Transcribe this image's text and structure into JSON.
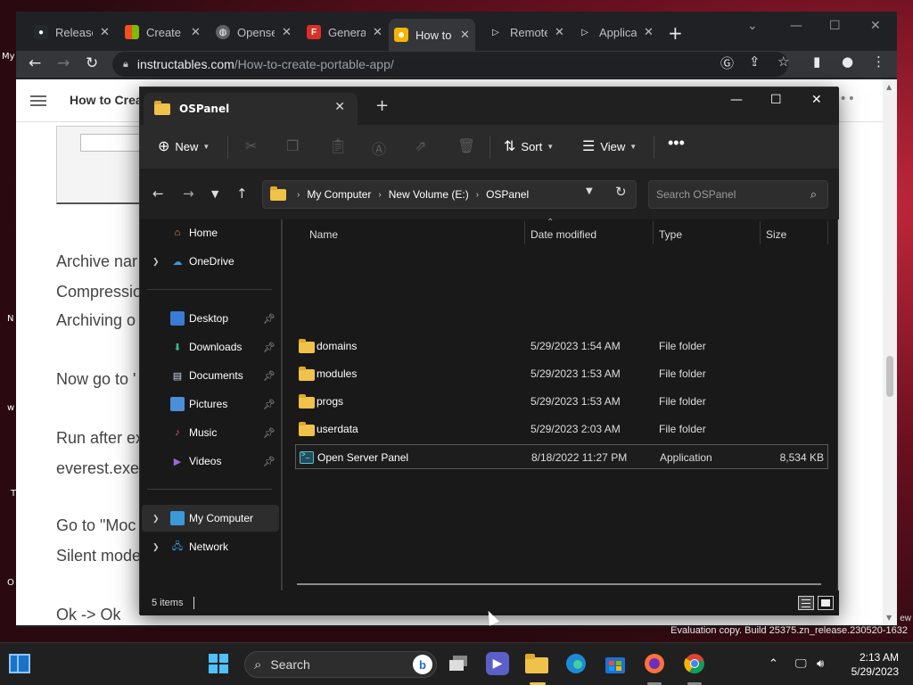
{
  "browser": {
    "tabs": [
      {
        "label": "Releases",
        "favicon": "github-icon",
        "color": "#24292e"
      },
      {
        "label": "Create",
        "favicon": "microsoft-icon",
        "color": "#f25022"
      },
      {
        "label": "Openserver",
        "favicon": "globe-icon",
        "color": "#5f6368"
      },
      {
        "label": "Generate",
        "favicon": "f-icon",
        "color": "#d93025"
      },
      {
        "label": "How to create",
        "favicon": "instructables-icon",
        "color": "#f4b400"
      },
      {
        "label": "Remote",
        "favicon": "play-icon",
        "color": "#202124"
      },
      {
        "label": "Application",
        "favicon": "play-icon",
        "color": "#202124"
      }
    ],
    "url_host": "instructables.com",
    "url_path": "/How-to-create-portable-app/",
    "page_title": "How to Crea",
    "page_lines": [
      "Archive nar",
      "Compressio",
      "Archiving o",
      "Now go to '",
      "Run after ex",
      "everest.exe",
      "Go to \"Moc",
      "Silent mode",
      "Ok -> Ok"
    ]
  },
  "explorer": {
    "tab_title": "OSPanel",
    "commands": {
      "new": "New",
      "sort": "Sort",
      "view": "View"
    },
    "breadcrumb": [
      "My Computer",
      "New Volume (E:)",
      "OSPanel"
    ],
    "search_placeholder": "Search OSPanel",
    "sidebar": [
      {
        "label": "Home",
        "icon": "home-icon",
        "expandable": false
      },
      {
        "label": "OneDrive",
        "icon": "cloud-icon",
        "expandable": true
      },
      {
        "label": "Desktop",
        "icon": "desktop-icon",
        "pinned": true
      },
      {
        "label": "Downloads",
        "icon": "download-icon",
        "pinned": true
      },
      {
        "label": "Documents",
        "icon": "document-icon",
        "pinned": true
      },
      {
        "label": "Pictures",
        "icon": "picture-icon",
        "pinned": true
      },
      {
        "label": "Music",
        "icon": "music-icon",
        "pinned": true
      },
      {
        "label": "Videos",
        "icon": "video-icon",
        "pinned": true
      },
      {
        "label": "My Computer",
        "icon": "computer-icon",
        "expandable": true,
        "selected": true
      },
      {
        "label": "Network",
        "icon": "network-icon",
        "expandable": true
      }
    ],
    "columns": {
      "name": "Name",
      "date": "Date modified",
      "type": "Type",
      "size": "Size"
    },
    "files": [
      {
        "name": "domains",
        "date": "5/29/2023 1:54 AM",
        "type": "File folder",
        "size": ""
      },
      {
        "name": "modules",
        "date": "5/29/2023 1:53 AM",
        "type": "File folder",
        "size": ""
      },
      {
        "name": "progs",
        "date": "5/29/2023 1:53 AM",
        "type": "File folder",
        "size": ""
      },
      {
        "name": "userdata",
        "date": "5/29/2023 2:03 AM",
        "type": "File folder",
        "size": ""
      },
      {
        "name": "Open Server Panel",
        "date": "8/18/2022 11:27 PM",
        "type": "Application",
        "size": "8,534 KB"
      }
    ],
    "status": "5 items"
  },
  "taskbar": {
    "search_label": "Search",
    "time": "2:13 AM",
    "date": "5/29/2023"
  },
  "desktop": {
    "watermark": "Evaluation copy. Build 25375.zn_release.230520-1632",
    "watermark_edge": "ew",
    "edge_icon_labels": [
      "My",
      "N",
      "w",
      "T",
      "O"
    ]
  },
  "colors": {
    "accent": "#0078d4",
    "folder": "#f0c24a",
    "explorer_bg": "#191919"
  }
}
